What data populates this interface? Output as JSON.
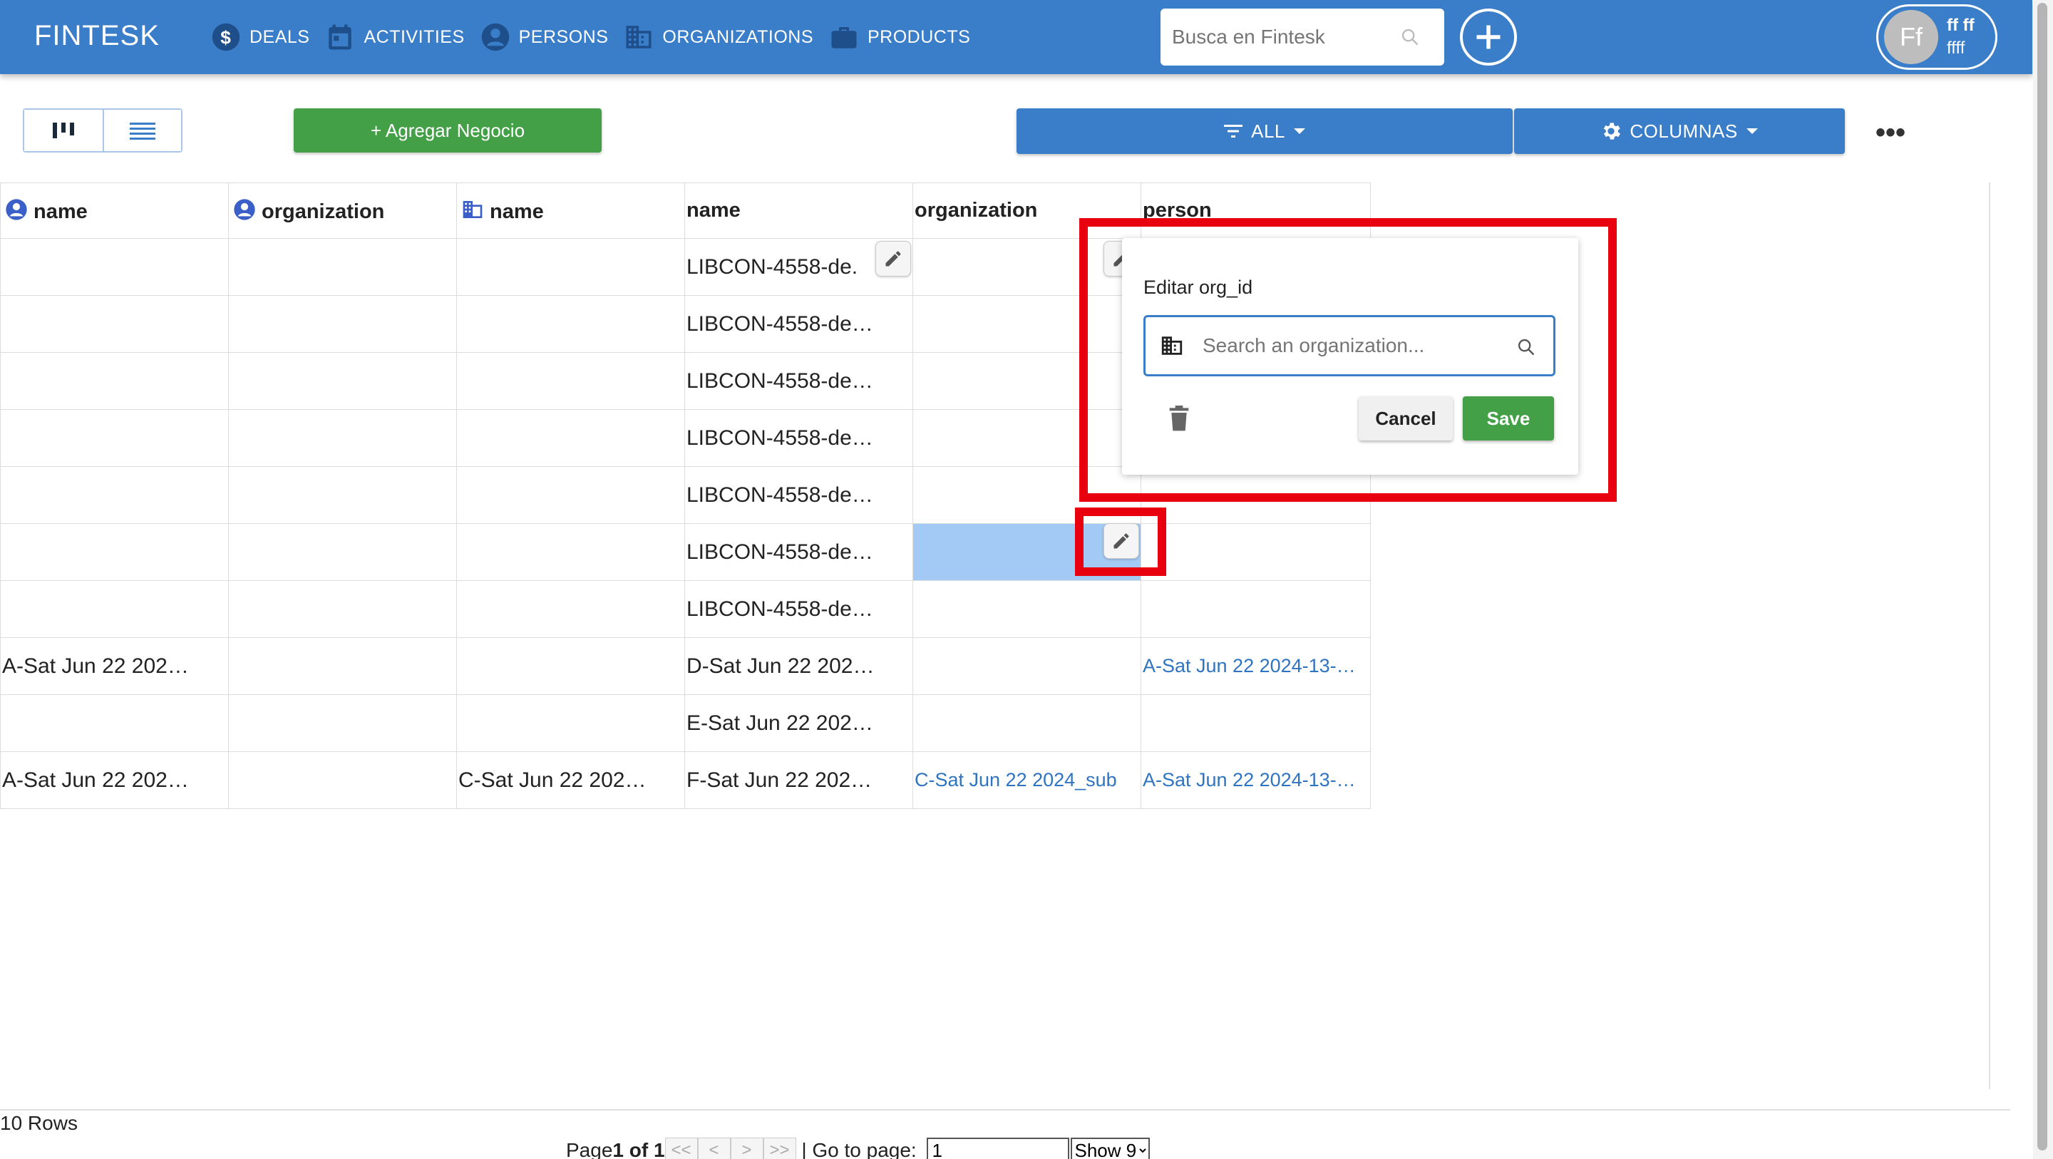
{
  "app": {
    "brand": "FINTESK",
    "nav": [
      {
        "label": "DEALS",
        "icon": "dollar-icon"
      },
      {
        "label": "ACTIVITIES",
        "icon": "calendar-icon"
      },
      {
        "label": "PERSONS",
        "icon": "person-icon"
      },
      {
        "label": "ORGANIZATIONS",
        "icon": "building-icon"
      },
      {
        "label": "PRODUCTS",
        "icon": "briefcase-icon"
      }
    ],
    "search_placeholder": "Busca en Fintesk",
    "user": {
      "initials": "Ff",
      "name": "ff ff",
      "subname": "ffff"
    }
  },
  "toolbar": {
    "add_deal_label": "+ Agregar Negocio",
    "filter_label": "ALL",
    "columns_label": "COLUMNAS",
    "more_label": "•••"
  },
  "table": {
    "headers": [
      {
        "label": "name",
        "icon": "person-icon"
      },
      {
        "label": "organization",
        "icon": "person-icon"
      },
      {
        "label": "name",
        "icon": "building-icon"
      },
      {
        "label": "name",
        "icon": ""
      },
      {
        "label": "organization",
        "icon": ""
      },
      {
        "label": "person",
        "icon": ""
      }
    ],
    "rows": [
      [
        "",
        "",
        "",
        "LIBCON-4558-de.",
        "",
        ""
      ],
      [
        "",
        "",
        "",
        "LIBCON-4558-de…",
        "",
        ""
      ],
      [
        "",
        "",
        "",
        "LIBCON-4558-de…",
        "",
        ""
      ],
      [
        "",
        "",
        "",
        "LIBCON-4558-de…",
        "",
        ""
      ],
      [
        "",
        "",
        "",
        "LIBCON-4558-de…",
        "",
        ""
      ],
      [
        "",
        "",
        "",
        "LIBCON-4558-de…",
        "",
        ""
      ],
      [
        "",
        "",
        "",
        "LIBCON-4558-de…",
        "",
        ""
      ],
      [
        "A-Sat Jun 22 202…",
        "",
        "",
        "D-Sat Jun 22 202…",
        "",
        "A-Sat Jun 22 2024-13-…"
      ],
      [
        "",
        "",
        "",
        "E-Sat Jun 22 202…",
        "",
        ""
      ],
      [
        "A-Sat Jun 22 202…",
        "",
        "C-Sat Jun 22 202…",
        "F-Sat Jun 22 202…",
        "C-Sat Jun 22 2024_sub",
        "A-Sat Jun 22 2024-13-…"
      ]
    ]
  },
  "popover": {
    "title": "Editar org_id",
    "search_placeholder": "Search an organization...",
    "cancel_label": "Cancel",
    "save_label": "Save"
  },
  "footer": {
    "rows_count": "10 Rows",
    "page_prefix": "Page ",
    "page_current": "1 of 1",
    "btn_first": "<<",
    "btn_prev": "<",
    "btn_next": ">",
    "btn_last": ">>",
    "goto_label": " | Go to page: ",
    "goto_value": "1",
    "show_options": [
      "Show 9"
    ]
  },
  "colors": {
    "primary": "#3a7dc9",
    "success": "#43a047",
    "highlight": "#e8000f",
    "link": "#2f74c0",
    "selected_cell": "#a3c9f5"
  }
}
